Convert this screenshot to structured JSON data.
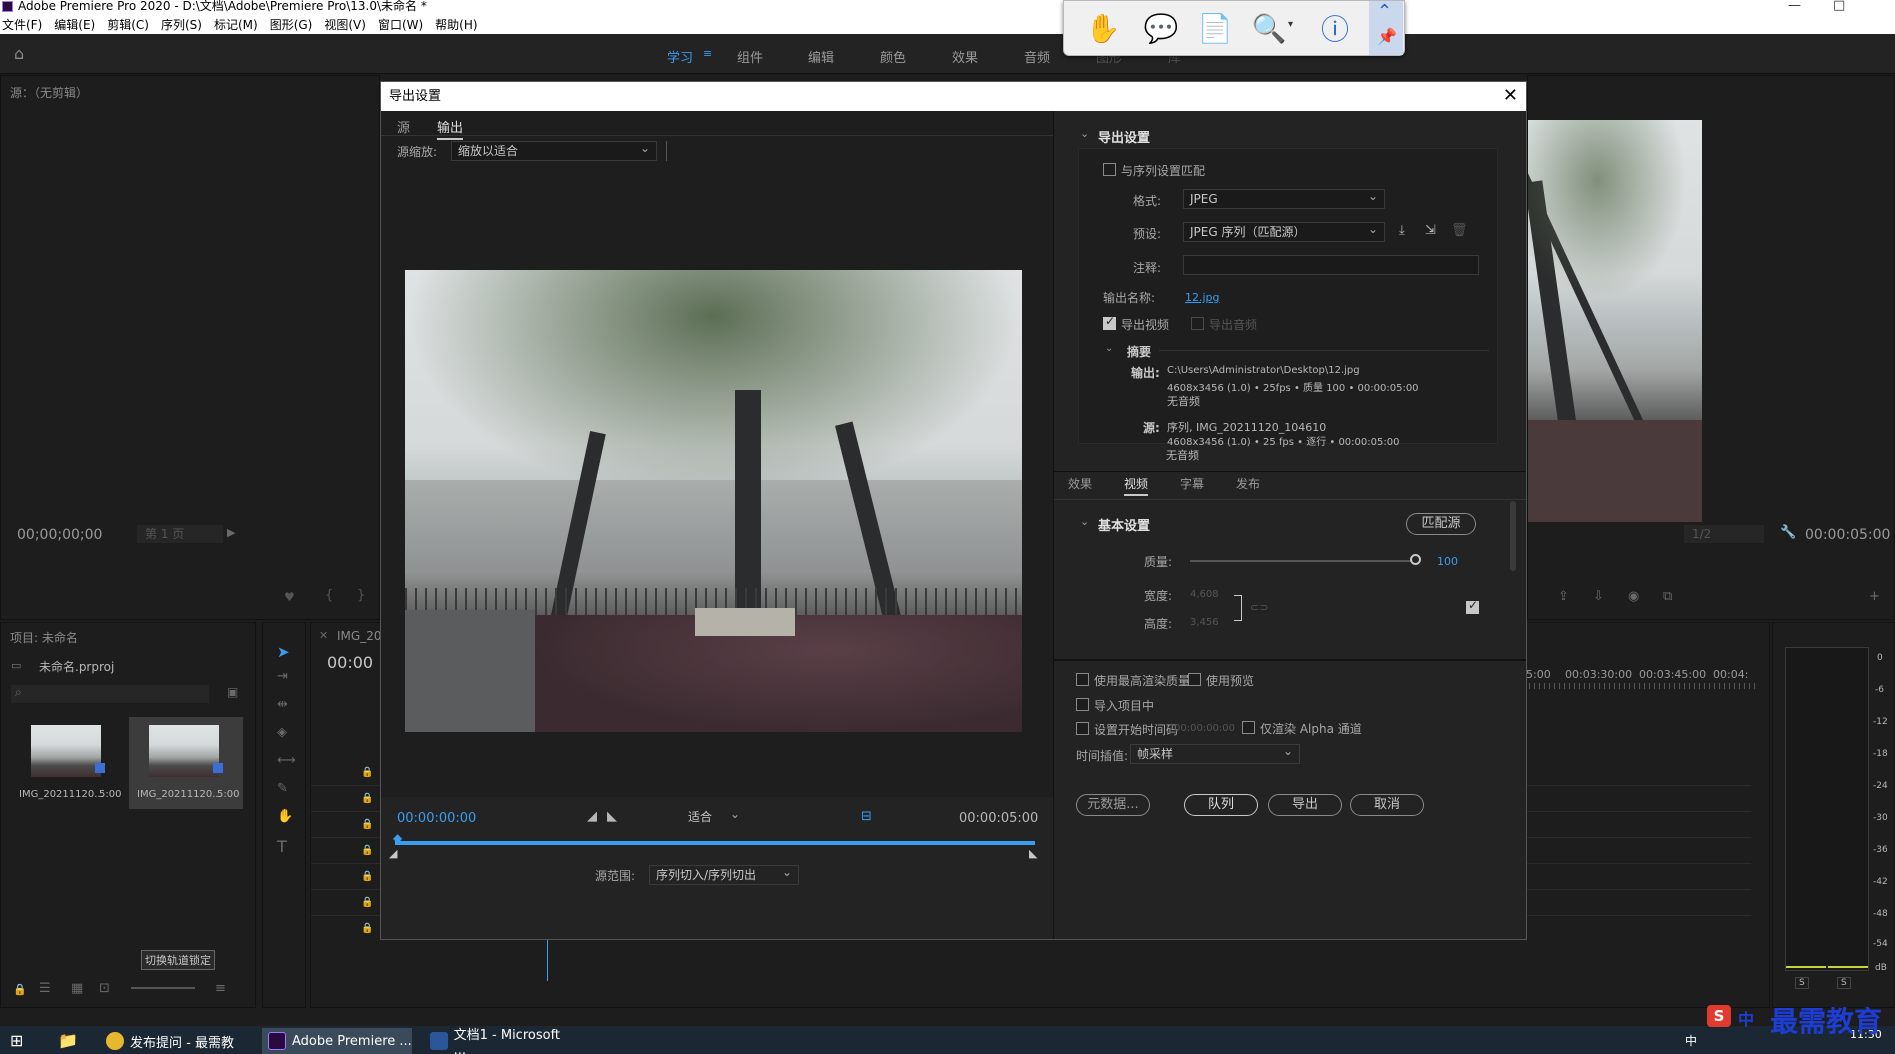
{
  "window": {
    "title": "Adobe Premiere Pro 2020 - D:\\文档\\Adobe\\Premiere Pro\\13.0\\未命名 *",
    "controls": [
      "—",
      "□",
      "✕"
    ]
  },
  "menu": [
    "文件(F)",
    "编辑(E)",
    "剪辑(C)",
    "序列(S)",
    "标记(M)",
    "图形(G)",
    "视图(V)",
    "窗口(W)",
    "帮助(H)"
  ],
  "workspaces": [
    {
      "label": "学习",
      "active": true
    },
    {
      "label": "组件",
      "active": false
    },
    {
      "label": "编辑",
      "active": false
    },
    {
      "label": "颜色",
      "active": false
    },
    {
      "label": "效果",
      "active": false
    },
    {
      "label": "音频",
      "active": false
    },
    {
      "label": "图形",
      "active": false
    },
    {
      "label": "库",
      "active": false
    }
  ],
  "source_panel": {
    "title": "源：（无剪辑）",
    "timecode": "00;00;00;00",
    "page": "第 1 页"
  },
  "program_panel": {
    "zoom": "1/2",
    "timecode": "00:00:05:00"
  },
  "project_panel": {
    "title": "项目: 未命名",
    "file": "未命名.prproj",
    "items": [
      {
        "name": "IMG_20211120...",
        "duration": "5:00"
      },
      {
        "name": "IMG_20211120...",
        "duration": "5:00"
      }
    ],
    "tooltip": "切换轨道锁定"
  },
  "timeline": {
    "tab": "IMG_202",
    "timecode": "00:00",
    "ruler": [
      "15:00",
      "00:03:30:00",
      "00:03:45:00",
      "00:04:"
    ]
  },
  "meter": {
    "ticks": [
      "0",
      "-6",
      "-12",
      "-18",
      "-24",
      "-30",
      "-36",
      "-42",
      "-48",
      "-54",
      "dB"
    ],
    "solo": [
      "S",
      "S"
    ]
  },
  "dialog": {
    "title": "导出设置",
    "close": "✕",
    "tabs": [
      {
        "label": "源",
        "active": false
      },
      {
        "label": "输出",
        "active": true
      }
    ],
    "source_scale_label": "源缩放:",
    "source_scale_value": "缩放以适合",
    "playback": {
      "current": "00:00:00:00",
      "fit": "适合",
      "end": "00:00:05:00",
      "range_label": "源范围:",
      "range_value": "序列切入/序列切出",
      "progress": 0
    },
    "export_settings": {
      "header": "导出设置",
      "match_sequence": "与序列设置匹配",
      "format_label": "格式:",
      "format_value": "JPEG",
      "preset_label": "预设:",
      "preset_value": "JPEG 序列（匹配源）",
      "comment_label": "注释:",
      "comment_value": "",
      "output_name_label": "输出名称:",
      "output_name_value": "12.jpg",
      "export_video": "导出视频",
      "export_audio": "导出音频",
      "summary_header": "摘要",
      "output_label": "输出:",
      "output_lines": [
        "C:\\Users\\Administrator\\Desktop\\12.jpg",
        "4608x3456 (1.0) • 25fps • 质量 100 • 00:00:05:00",
        "无音频"
      ],
      "source_label": "源:",
      "source_lines": [
        "序列, IMG_20211120_104610",
        "4608x3456 (1.0) • 25 fps • 逐行 • 00:00:05:00",
        "无音频"
      ]
    },
    "settings_tabs": [
      {
        "label": "效果",
        "active": false
      },
      {
        "label": "视频",
        "active": true
      },
      {
        "label": "字幕",
        "active": false
      },
      {
        "label": "发布",
        "active": false
      }
    ],
    "basic_settings": {
      "header": "基本设置",
      "match_source": "匹配源",
      "quality_label": "质量:",
      "quality_value": "100",
      "width_label": "宽度:",
      "width_value": "4,608",
      "height_label": "高度:",
      "height_value": "3,456"
    },
    "options": {
      "max_render": "使用最高渲染质量",
      "use_previews": "使用预览",
      "import_project": "导入项目中",
      "set_start_tc": "设置开始时间码",
      "start_tc_value": "00:00:00:00",
      "alpha_only": "仅渲染 Alpha 通道",
      "interp_label": "时间插值:",
      "interp_value": "帧采样"
    },
    "buttons": {
      "metadata": "元数据...",
      "queue": "队列",
      "export": "导出",
      "cancel": "取消"
    }
  },
  "taskbar": {
    "items": [
      {
        "label": "发布提问 - 最需教",
        "color": "#e8b730"
      },
      {
        "label": "Adobe Premiere ...",
        "color": "#2a0b3f"
      },
      {
        "label": "文档1 - Microsoft ...",
        "color": "#2b579a"
      }
    ],
    "tray": [
      "中",
      "11:30"
    ]
  },
  "watermark": "最需教育",
  "sogou": "中"
}
